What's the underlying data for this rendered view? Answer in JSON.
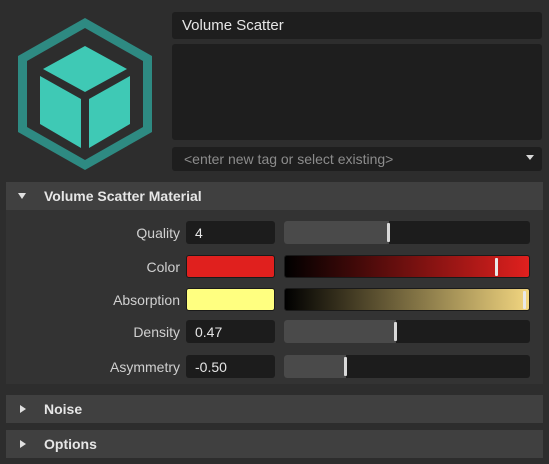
{
  "material": {
    "name": "Volume Scatter",
    "notes": "",
    "tag_placeholder": "<enter new tag or select existing>",
    "icon": "cube-material-icon"
  },
  "sections": {
    "main": {
      "title": "Volume Scatter Material",
      "expanded": true
    },
    "noise": {
      "title": "Noise",
      "expanded": false
    },
    "options": {
      "title": "Options",
      "expanded": false
    }
  },
  "params": {
    "quality": {
      "label": "Quality",
      "value": "4",
      "slider_fraction": 0.425
    },
    "color": {
      "label": "Color",
      "color": "#e0201e",
      "gradient_end": "#e0201e",
      "slider_fraction": 0.87
    },
    "absorption": {
      "label": "Absorption",
      "color": "#ffff80",
      "gradient_end": "#f2d680",
      "slider_fraction": 0.985
    },
    "density": {
      "label": "Density",
      "value": "0.47",
      "slider_fraction": 0.455
    },
    "asymmetry": {
      "label": "Asymmetry",
      "value": "-0.50",
      "slider_fraction": 0.25
    }
  },
  "colors": {
    "background": "#2d2d2d",
    "field": "#1e1e1e",
    "section_header": "#404040",
    "icon_teal": "#3fc9b5",
    "icon_frame": "#2e8a82"
  }
}
